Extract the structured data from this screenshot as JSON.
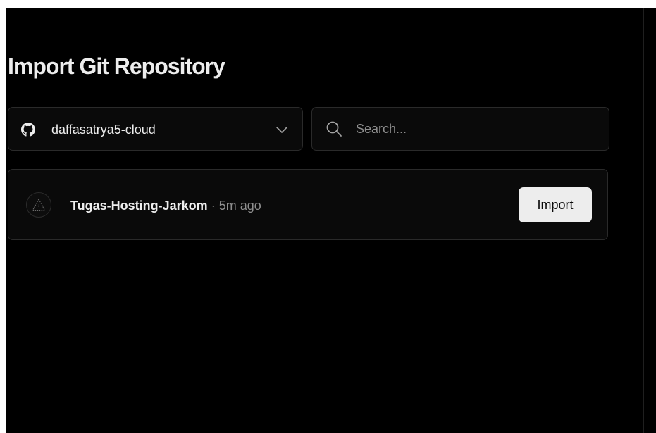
{
  "page": {
    "title": "Import Git Repository"
  },
  "account_select": {
    "provider_icon": "github-icon",
    "selected_account": "daffasatrya5-cloud",
    "chevron_icon": "chevron-down-icon"
  },
  "search": {
    "icon": "search-icon",
    "placeholder": "Search...",
    "value": ""
  },
  "repositories": [
    {
      "avatar_icon": "triangle-icon",
      "name": "Tugas-Hosting-Jarkom",
      "separator": " · ",
      "updated": "5m ago",
      "action_label": "Import"
    }
  ],
  "colors": {
    "background": "#000000",
    "panel": "#0a0a0a",
    "border": "#2a2a2a",
    "text_primary": "#ededed",
    "text_secondary": "#8f8f8f",
    "button_bg": "#ededed",
    "button_text": "#0a0a0a"
  }
}
